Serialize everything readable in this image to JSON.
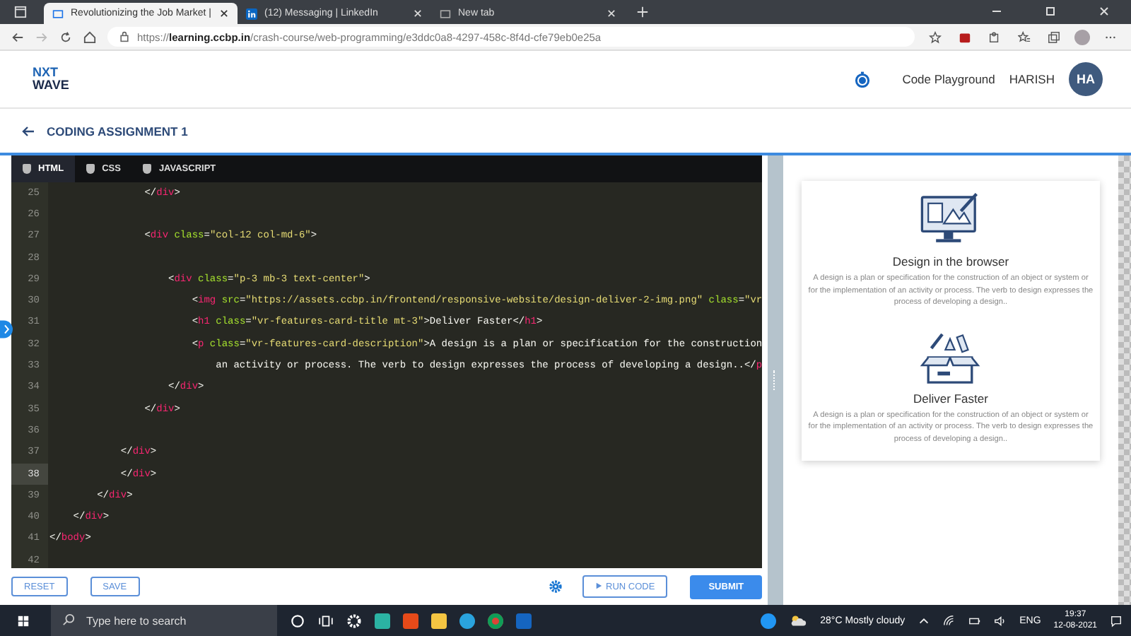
{
  "browser": {
    "tabs": [
      {
        "title": "Revolutionizing the Job Market |",
        "selected": true,
        "kind": "page"
      },
      {
        "title": "(12) Messaging | LinkedIn",
        "selected": false,
        "kind": "linkedin"
      },
      {
        "title": "New tab",
        "selected": false,
        "kind": "page"
      }
    ],
    "url": "https://**learning.ccbp.in**/crash-course/web-programming/e3ddc0a8-4297-458c-8f4d-cfe79eb0e25a"
  },
  "header": {
    "logo_top": "NXT",
    "logo_bottom": "WAVE",
    "link": "Code Playground",
    "user_name": "HARISH",
    "avatar_initials": "HA"
  },
  "assignment": {
    "title": "CODING ASSIGNMENT 1"
  },
  "editor": {
    "tabs": [
      {
        "label": "HTML",
        "selected": true
      },
      {
        "label": "CSS",
        "selected": false
      },
      {
        "label": "JAVASCRIPT",
        "selected": false
      }
    ],
    "lines": [
      {
        "number": "25",
        "current": false,
        "tokens": [
          {
            "kind": "punct",
            "text": "                </"
          },
          {
            "kind": "tag",
            "text": "div"
          },
          {
            "kind": "punct",
            "text": ">"
          }
        ]
      },
      {
        "number": "26",
        "current": false
      },
      {
        "number": "27",
        "current": false,
        "tokens": [
          {
            "kind": "punct",
            "text": "                <"
          },
          {
            "kind": "tag",
            "text": "div"
          },
          {
            "kind": "attr",
            "text": " class"
          },
          {
            "kind": "punct",
            "text": "="
          },
          {
            "kind": "str",
            "text": "\"col-12 col-md-6\""
          },
          {
            "kind": "punct",
            "text": ">"
          }
        ]
      },
      {
        "number": "28",
        "current": false
      },
      {
        "number": "29",
        "current": false,
        "tokens": [
          {
            "kind": "punct",
            "text": "                    <"
          },
          {
            "kind": "tag",
            "text": "div"
          },
          {
            "kind": "attr",
            "text": " class"
          },
          {
            "kind": "punct",
            "text": "="
          },
          {
            "kind": "str",
            "text": "\"p-3 mb-3 text-center\""
          },
          {
            "kind": "punct",
            "text": ">"
          }
        ]
      },
      {
        "number": "30",
        "current": false,
        "tokens": [
          {
            "kind": "punct",
            "text": "                        <"
          },
          {
            "kind": "tag",
            "text": "img"
          },
          {
            "kind": "attr",
            "text": " src"
          },
          {
            "kind": "punct",
            "text": "="
          },
          {
            "kind": "str",
            "text": "\"https://assets.ccbp.in/frontend/responsive-website/design-deliver-2-img.png\""
          },
          {
            "kind": "attr",
            "text": " class"
          },
          {
            "kind": "punct",
            "text": "="
          },
          {
            "kind": "str",
            "text": "\"vr"
          }
        ]
      },
      {
        "number": "31",
        "current": false,
        "tokens": [
          {
            "kind": "punct",
            "text": "                        <"
          },
          {
            "kind": "tag",
            "text": "h1"
          },
          {
            "kind": "attr",
            "text": " class"
          },
          {
            "kind": "punct",
            "text": "="
          },
          {
            "kind": "str",
            "text": "\"vr-features-card-title mt-3\""
          },
          {
            "kind": "punct",
            "text": ">"
          },
          {
            "kind": "text",
            "text": "Deliver Faster"
          },
          {
            "kind": "punct",
            "text": "</"
          },
          {
            "kind": "tag",
            "text": "h1"
          },
          {
            "kind": "punct",
            "text": ">"
          }
        ]
      },
      {
        "number": "32",
        "current": false,
        "tokens": [
          {
            "kind": "punct",
            "text": "                        <"
          },
          {
            "kind": "tag",
            "text": "p"
          },
          {
            "kind": "attr",
            "text": " class"
          },
          {
            "kind": "punct",
            "text": "="
          },
          {
            "kind": "str",
            "text": "\"vr-features-card-description\""
          },
          {
            "kind": "punct",
            "text": ">"
          },
          {
            "kind": "text",
            "text": "A design is a plan or specification for the construction"
          }
        ]
      },
      {
        "number": "33",
        "current": false,
        "tokens": [
          {
            "kind": "text",
            "text": "                            an activity or process. The verb to design expresses the process of developing a design.."
          },
          {
            "kind": "punct",
            "text": "</"
          },
          {
            "kind": "tag",
            "text": "p"
          }
        ]
      },
      {
        "number": "34",
        "current": false,
        "tokens": [
          {
            "kind": "punct",
            "text": "                    </"
          },
          {
            "kind": "tag",
            "text": "div"
          },
          {
            "kind": "punct",
            "text": ">"
          }
        ]
      },
      {
        "number": "35",
        "current": false,
        "tokens": [
          {
            "kind": "punct",
            "text": "                </"
          },
          {
            "kind": "tag",
            "text": "div"
          },
          {
            "kind": "punct",
            "text": ">"
          }
        ]
      },
      {
        "number": "36",
        "current": false
      },
      {
        "number": "37",
        "current": false,
        "tokens": [
          {
            "kind": "punct",
            "text": "            </"
          },
          {
            "kind": "tag",
            "text": "div"
          },
          {
            "kind": "punct",
            "text": ">"
          }
        ]
      },
      {
        "number": "38",
        "current": true,
        "tokens": [
          {
            "kind": "punct",
            "text": "            </"
          },
          {
            "kind": "tag",
            "text": "div"
          },
          {
            "kind": "punct",
            "text": ">"
          }
        ]
      },
      {
        "number": "39",
        "current": false,
        "tokens": [
          {
            "kind": "punct",
            "text": "        </"
          },
          {
            "kind": "tag",
            "text": "div"
          },
          {
            "kind": "punct",
            "text": ">"
          }
        ]
      },
      {
        "number": "40",
        "current": false,
        "tokens": [
          {
            "kind": "punct",
            "text": "    </"
          },
          {
            "kind": "tag",
            "text": "div"
          },
          {
            "kind": "punct",
            "text": ">"
          }
        ]
      },
      {
        "number": "41",
        "current": false,
        "tokens": [
          {
            "kind": "punct",
            "text": "</"
          },
          {
            "kind": "tag",
            "text": "body"
          },
          {
            "kind": "punct",
            "text": ">"
          }
        ]
      },
      {
        "number": "42",
        "current": false
      }
    ],
    "buttons": {
      "reset": "RESET",
      "save": "SAVE",
      "run": "RUN CODE",
      "submit": "SUBMIT"
    }
  },
  "preview": {
    "features": [
      {
        "kind": "monitor",
        "title": "Design in the browser",
        "description": "A design is a plan or specification for the construction of an object or system or for the implementation of an activity or process. The verb to design expresses the process of developing a design.."
      },
      {
        "kind": "box",
        "title": "Deliver Faster",
        "description": "A design is a plan or specification for the construction of an object or system or for the implementation of an activity or process. The verb to design expresses the process of developing a design.."
      }
    ]
  },
  "taskbar": {
    "search_placeholder": "Type here to search",
    "weather": "28°C  Mostly cloudy",
    "language": "ENG",
    "time": "19:37",
    "date": "12-08-2021"
  }
}
